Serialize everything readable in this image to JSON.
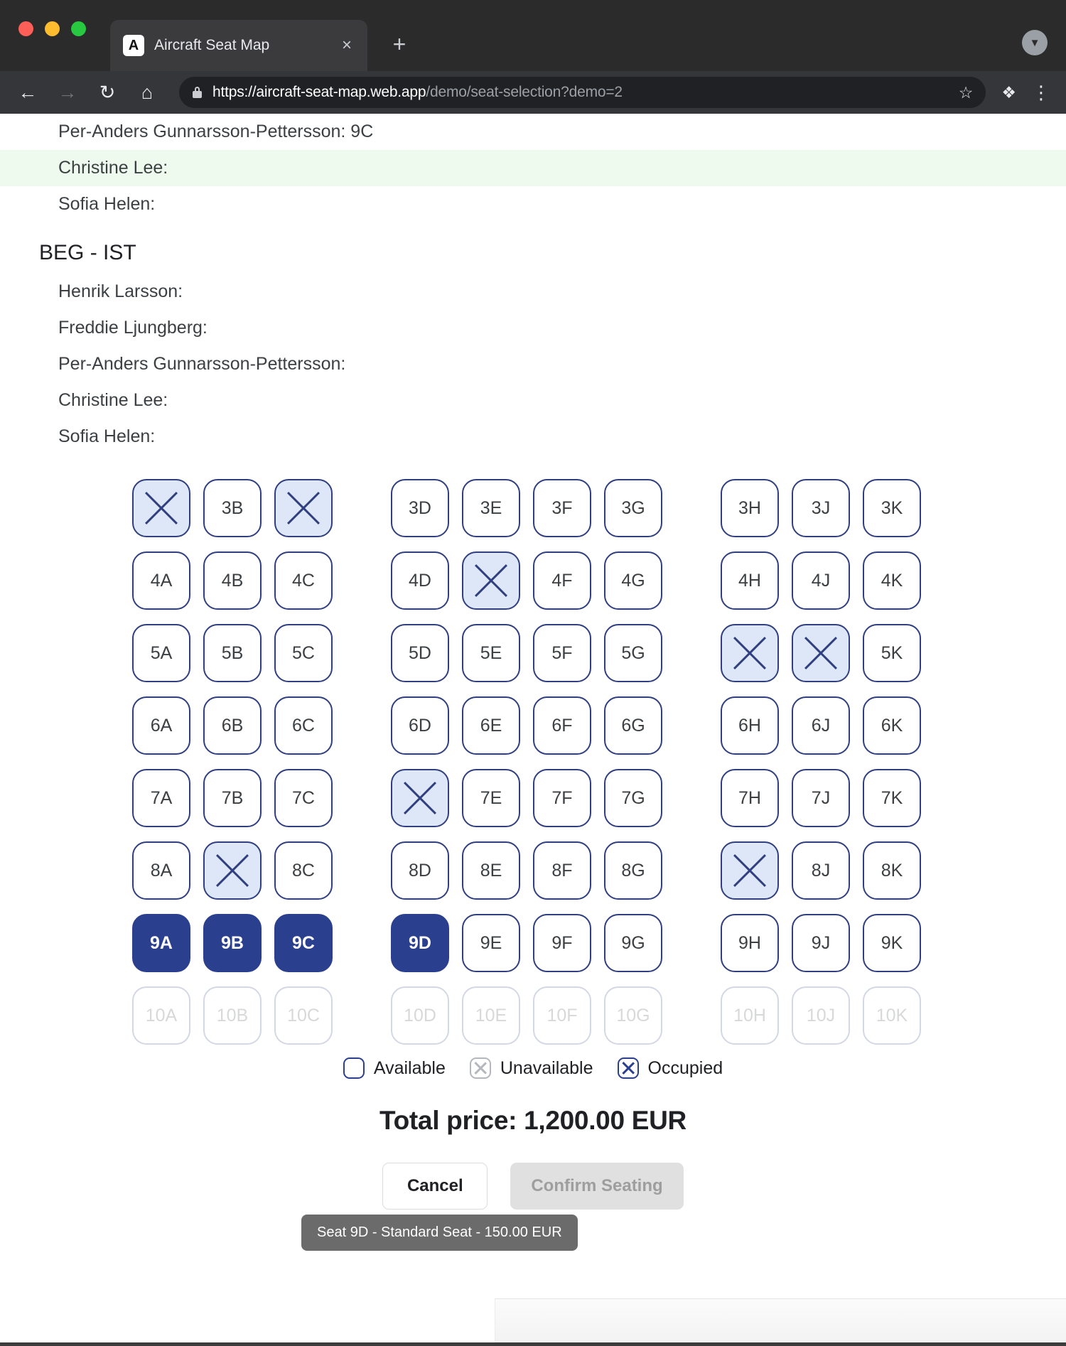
{
  "browser": {
    "tab": {
      "title": "Aircraft Seat Map",
      "favicon": "A",
      "close_icon": "×"
    },
    "new_tab_icon": "+",
    "profile_icon": "▼",
    "nav": {
      "back": "←",
      "forward": "→",
      "reload": "↻",
      "home": "⌂"
    },
    "url": {
      "bold": "https://aircraft-seat-map.web.app",
      "dim": "/demo/seat-selection?demo=2"
    },
    "star_icon": "☆",
    "puzzle_icon": "❖",
    "menu_icon": "⋮"
  },
  "passengers_top": [
    {
      "label": "Per-Anders Gunnarsson-Pettersson: 9C",
      "highlight": false
    },
    {
      "label": "Christine Lee:",
      "highlight": true
    },
    {
      "label": "Sofia Helen:",
      "highlight": false
    }
  ],
  "route": {
    "title": "BEG - IST"
  },
  "passengers_bottom": [
    {
      "label": "Henrik Larsson:",
      "highlight": false
    },
    {
      "label": "Freddie Ljungberg:",
      "highlight": false
    },
    {
      "label": "Per-Anders Gunnarsson-Pettersson:",
      "highlight": false
    },
    {
      "label": "Christine Lee:",
      "highlight": false
    },
    {
      "label": "Sofia Helen:",
      "highlight": false
    }
  ],
  "seatmap": {
    "rows": [
      {
        "number": "3",
        "faded": false,
        "seats": [
          {
            "id": "3A",
            "state": "occupied"
          },
          {
            "id": "3B",
            "state": "available"
          },
          {
            "id": "3C",
            "state": "occupied",
            "aisle": true
          },
          {
            "id": "3D",
            "state": "available"
          },
          {
            "id": "3E",
            "state": "available"
          },
          {
            "id": "3F",
            "state": "available"
          },
          {
            "id": "3G",
            "state": "available",
            "aisle": true
          },
          {
            "id": "3H",
            "state": "available"
          },
          {
            "id": "3J",
            "state": "available"
          },
          {
            "id": "3K",
            "state": "available"
          }
        ]
      },
      {
        "number": "4",
        "faded": false,
        "seats": [
          {
            "id": "4A",
            "state": "available"
          },
          {
            "id": "4B",
            "state": "available"
          },
          {
            "id": "4C",
            "state": "available",
            "aisle": true
          },
          {
            "id": "4D",
            "state": "available"
          },
          {
            "id": "4E",
            "state": "occupied"
          },
          {
            "id": "4F",
            "state": "available"
          },
          {
            "id": "4G",
            "state": "available",
            "aisle": true
          },
          {
            "id": "4H",
            "state": "available"
          },
          {
            "id": "4J",
            "state": "available"
          },
          {
            "id": "4K",
            "state": "available"
          }
        ]
      },
      {
        "number": "5",
        "faded": false,
        "seats": [
          {
            "id": "5A",
            "state": "available"
          },
          {
            "id": "5B",
            "state": "available"
          },
          {
            "id": "5C",
            "state": "available",
            "aisle": true
          },
          {
            "id": "5D",
            "state": "available"
          },
          {
            "id": "5E",
            "state": "available"
          },
          {
            "id": "5F",
            "state": "available"
          },
          {
            "id": "5G",
            "state": "available",
            "aisle": true
          },
          {
            "id": "5H",
            "state": "occupied"
          },
          {
            "id": "5J",
            "state": "occupied"
          },
          {
            "id": "5K",
            "state": "available"
          }
        ]
      },
      {
        "number": "6",
        "faded": false,
        "seats": [
          {
            "id": "6A",
            "state": "available"
          },
          {
            "id": "6B",
            "state": "available"
          },
          {
            "id": "6C",
            "state": "available",
            "aisle": true
          },
          {
            "id": "6D",
            "state": "available"
          },
          {
            "id": "6E",
            "state": "available"
          },
          {
            "id": "6F",
            "state": "available"
          },
          {
            "id": "6G",
            "state": "available",
            "aisle": true
          },
          {
            "id": "6H",
            "state": "available"
          },
          {
            "id": "6J",
            "state": "available"
          },
          {
            "id": "6K",
            "state": "available"
          }
        ]
      },
      {
        "number": "7",
        "faded": false,
        "seats": [
          {
            "id": "7A",
            "state": "available"
          },
          {
            "id": "7B",
            "state": "available"
          },
          {
            "id": "7C",
            "state": "available",
            "aisle": true
          },
          {
            "id": "7D",
            "state": "occupied"
          },
          {
            "id": "7E",
            "state": "available"
          },
          {
            "id": "7F",
            "state": "available"
          },
          {
            "id": "7G",
            "state": "available",
            "aisle": true
          },
          {
            "id": "7H",
            "state": "available"
          },
          {
            "id": "7J",
            "state": "available"
          },
          {
            "id": "7K",
            "state": "available"
          }
        ]
      },
      {
        "number": "8",
        "faded": false,
        "seats": [
          {
            "id": "8A",
            "state": "available"
          },
          {
            "id": "8B",
            "state": "occupied"
          },
          {
            "id": "8C",
            "state": "available",
            "aisle": true
          },
          {
            "id": "8D",
            "state": "available"
          },
          {
            "id": "8E",
            "state": "available"
          },
          {
            "id": "8F",
            "state": "available"
          },
          {
            "id": "8G",
            "state": "available",
            "aisle": true
          },
          {
            "id": "8H",
            "state": "occupied"
          },
          {
            "id": "8J",
            "state": "available"
          },
          {
            "id": "8K",
            "state": "available"
          }
        ]
      },
      {
        "number": "9",
        "faded": false,
        "seats": [
          {
            "id": "9A",
            "state": "selected"
          },
          {
            "id": "9B",
            "state": "selected"
          },
          {
            "id": "9C",
            "state": "selected",
            "aisle": true
          },
          {
            "id": "9D",
            "state": "selected"
          },
          {
            "id": "9E",
            "state": "available"
          },
          {
            "id": "9F",
            "state": "available"
          },
          {
            "id": "9G",
            "state": "available",
            "aisle": true
          },
          {
            "id": "9H",
            "state": "available"
          },
          {
            "id": "9J",
            "state": "available"
          },
          {
            "id": "9K",
            "state": "available"
          }
        ]
      },
      {
        "number": "10",
        "faded": true,
        "seats": [
          {
            "id": "10A",
            "state": "available"
          },
          {
            "id": "10B",
            "state": "available"
          },
          {
            "id": "10C",
            "state": "available",
            "aisle": true
          },
          {
            "id": "10D",
            "state": "available"
          },
          {
            "id": "10E",
            "state": "available"
          },
          {
            "id": "10F",
            "state": "available"
          },
          {
            "id": "10G",
            "state": "available",
            "aisle": true
          },
          {
            "id": "10H",
            "state": "available"
          },
          {
            "id": "10J",
            "state": "available"
          },
          {
            "id": "10K",
            "state": "available"
          }
        ]
      }
    ]
  },
  "tooltip": {
    "text": "Seat 9D - Standard Seat - 150.00 EUR"
  },
  "legend": [
    {
      "label": "Available",
      "style": "avail"
    },
    {
      "label": "Unavailable",
      "style": "unavail"
    },
    {
      "label": "Occupied",
      "style": "occ"
    }
  ],
  "total": {
    "label": "Total price: 1,200.00 EUR"
  },
  "actions": {
    "cancel": "Cancel",
    "confirm": "Confirm Seating"
  },
  "colors": {
    "seat_border": "#2f3f7f",
    "seat_selected": "#2b3f8f",
    "seat_occupied_fill": "#dee7f8",
    "highlight_row": "#eefaee",
    "tooltip_bg": "#6b6b6b"
  }
}
